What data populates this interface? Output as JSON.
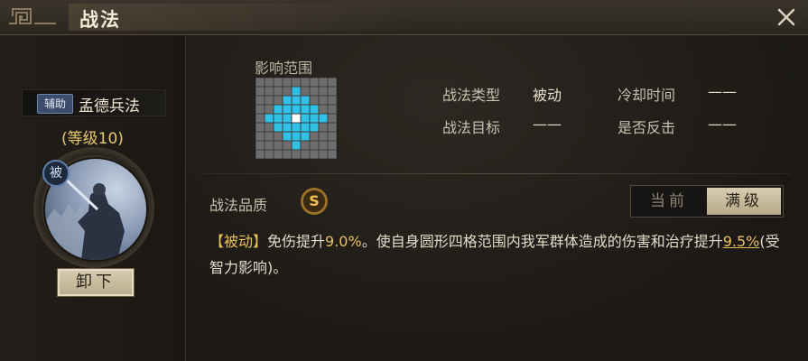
{
  "window": {
    "title": "战法"
  },
  "skill": {
    "type_badge": "辅助",
    "name": "孟德兵法",
    "level": "(等级10)",
    "passive_badge": "被",
    "unequip_label": "卸下"
  },
  "range": {
    "title": "影响范围",
    "rows": [
      [
        0,
        0,
        0,
        0,
        0,
        0,
        0,
        0,
        0
      ],
      [
        0,
        0,
        0,
        0,
        1,
        0,
        0,
        0,
        0
      ],
      [
        0,
        0,
        0,
        1,
        1,
        1,
        0,
        0,
        0
      ],
      [
        0,
        0,
        1,
        1,
        1,
        1,
        1,
        0,
        0
      ],
      [
        0,
        1,
        1,
        1,
        2,
        1,
        1,
        1,
        0
      ],
      [
        0,
        0,
        1,
        1,
        1,
        1,
        1,
        0,
        0
      ],
      [
        0,
        0,
        0,
        1,
        1,
        1,
        0,
        0,
        0
      ],
      [
        0,
        0,
        0,
        0,
        1,
        0,
        0,
        0,
        0
      ],
      [
        0,
        0,
        0,
        0,
        0,
        0,
        0,
        0,
        0
      ]
    ],
    "colors": {
      "empty": "#6e6e6e",
      "affected": "#2fc1e6",
      "center": "#ffffff",
      "line": "#3c3c3c"
    }
  },
  "info": {
    "type_label": "战法类型",
    "type_value": "被动",
    "cooldown_label": "冷却时间",
    "cooldown_value": "——",
    "target_label": "战法目标",
    "target_value": "——",
    "counter_label": "是否反击",
    "counter_value": "——"
  },
  "quality": {
    "label": "战法品质",
    "grade": "S"
  },
  "tabs": {
    "current": "当前",
    "max": "满级"
  },
  "description": {
    "tag": "【被动】",
    "part1": "免伤提升",
    "val1": "9.0%",
    "part2": "。使自身圆形四格范围内我军群体造成的伤害和治疗提升",
    "val2": "9.5%",
    "part3": "(受智力影响)。"
  }
}
